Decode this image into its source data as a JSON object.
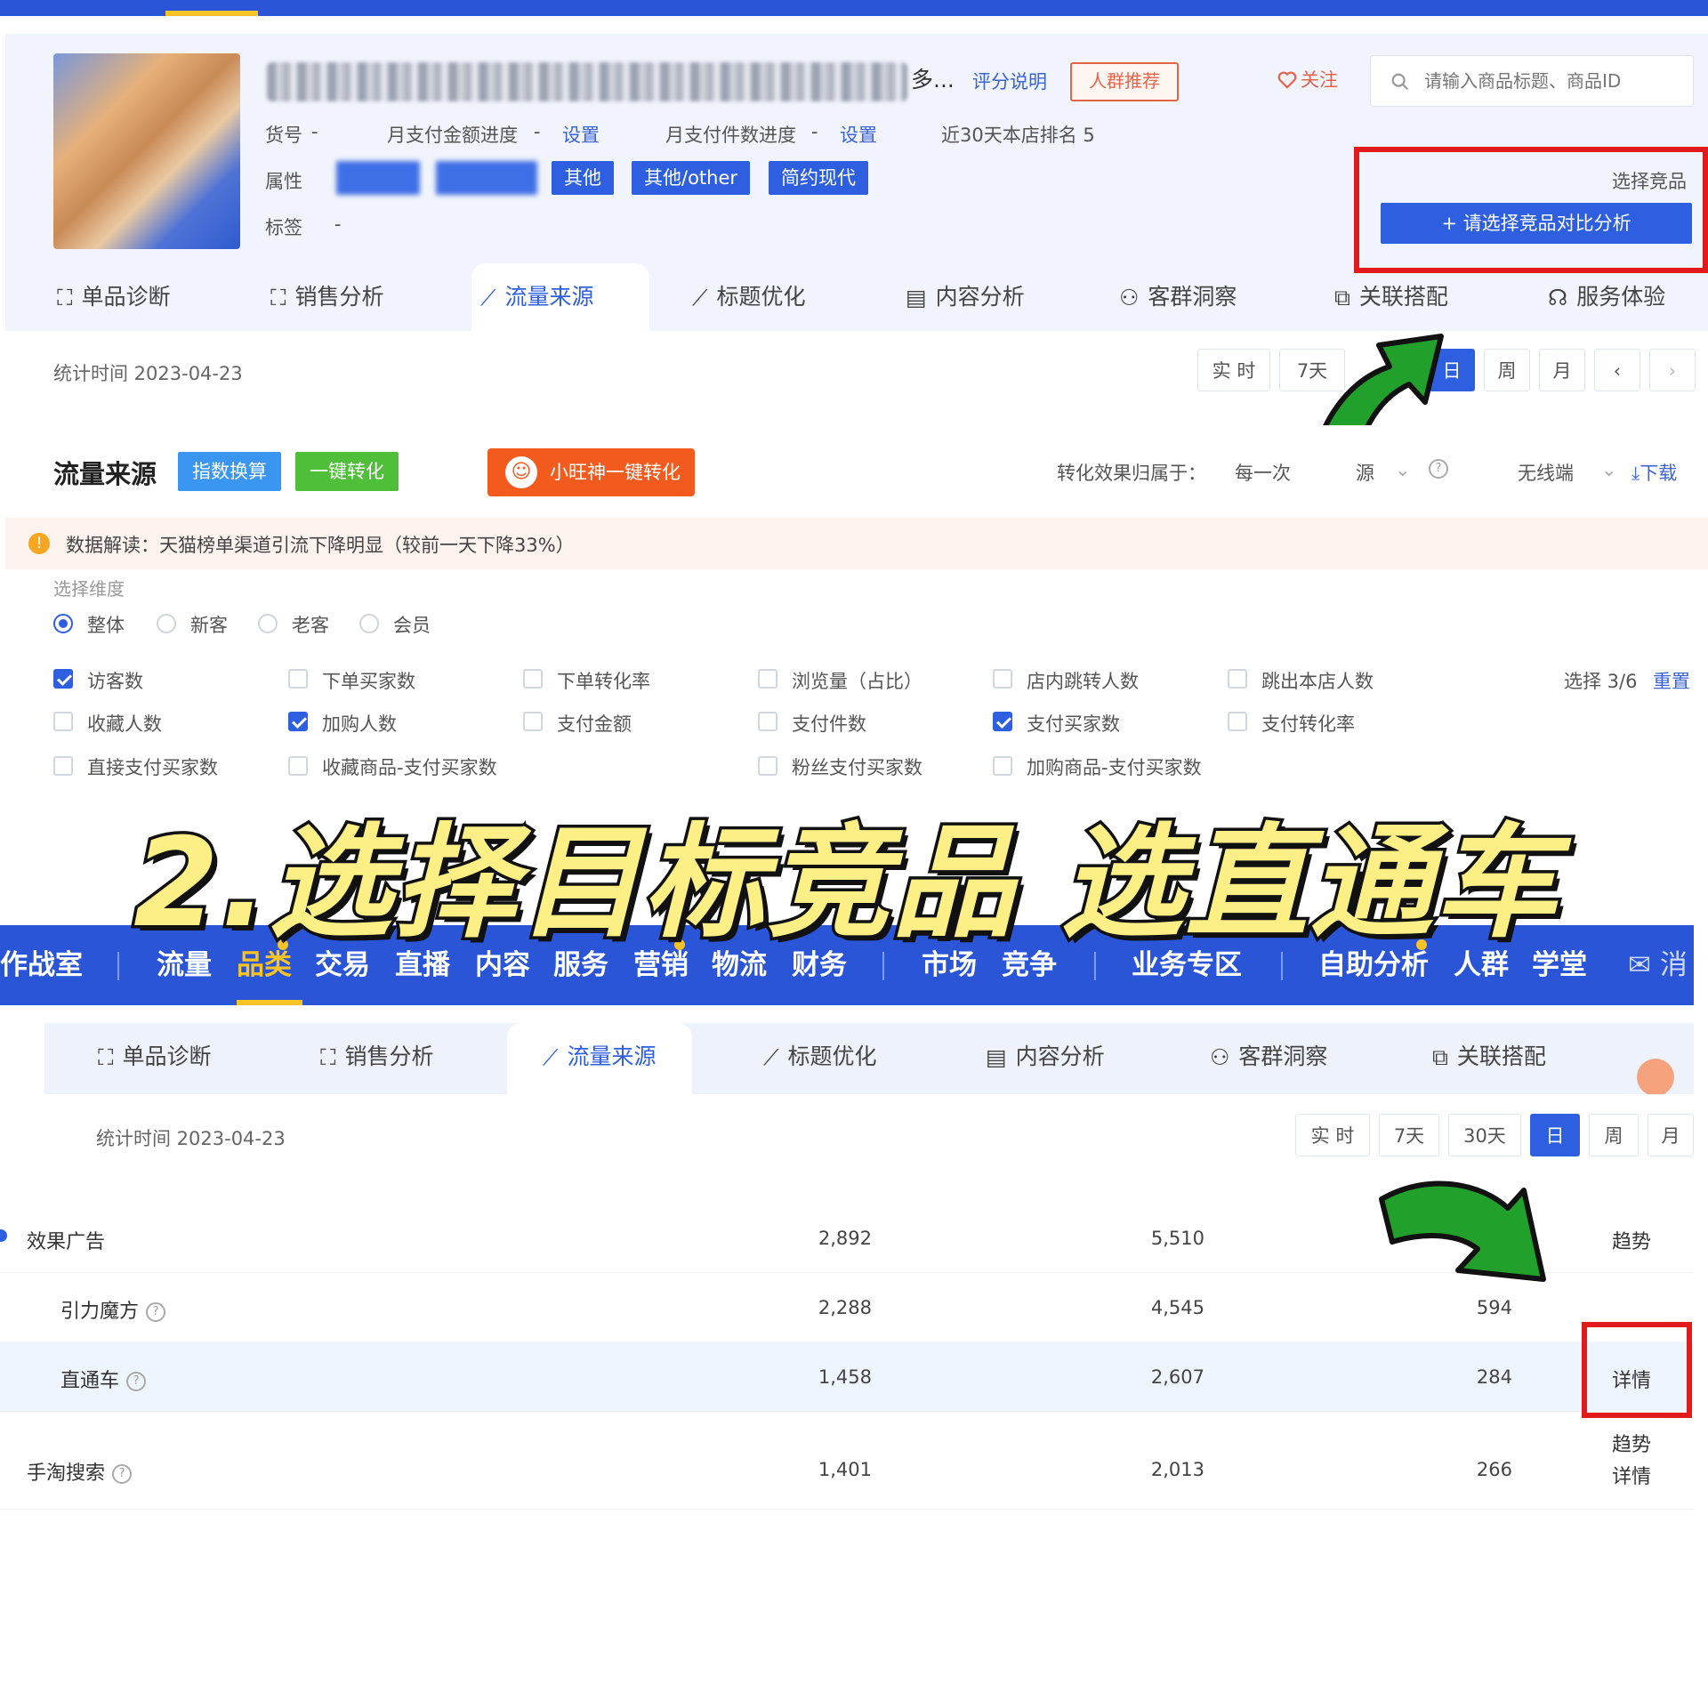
{
  "product": {
    "title_suffix": "多...",
    "rating_link": "评分说明",
    "crowd_button": "人群推荐",
    "follow": "关注",
    "search_placeholder": "请输入商品标题、商品ID",
    "sku_label": "货号",
    "sku_value": "-",
    "monthly_amount_label": "月支付金额进度",
    "monthly_amount_value": "-",
    "monthly_amount_set": "设置",
    "monthly_count_label": "月支付件数进度",
    "monthly_count_value": "-",
    "monthly_count_set": "设置",
    "rank_text": "近30天本店排名 5",
    "attr_label": "属性",
    "attrs": [
      "其他",
      "其他/other",
      "简约现代"
    ],
    "tag_label": "标签",
    "tag_value": "-",
    "compare_title": "选择竞品",
    "compare_button": "+ 请选择竞品对比分析"
  },
  "tabs": [
    "单品诊断",
    "销售分析",
    "流量来源",
    "标题优化",
    "内容分析",
    "客群洞察",
    "关联搭配",
    "服务体验"
  ],
  "stat": {
    "time_label": "统计时间 2023-04-23",
    "periods_top": [
      "实 时",
      "7天",
      "日",
      "周",
      "月"
    ],
    "periods_bottom": [
      "实 时",
      "7天",
      "30天",
      "日",
      "周",
      "月"
    ]
  },
  "traffic": {
    "title": "流量来源",
    "btn_index": "指数换算",
    "btn_convert": "一键转化",
    "btn_wang": "小旺神一键转化",
    "attribution_label": "转化效果归属于：",
    "attribution_value": "每一次",
    "attribution_tail": "源",
    "device": "无线端",
    "download": "下载",
    "notice": "数据解读：天猫榜单渠道引流下降明显（较前一天下降33%）",
    "dimension_label": "选择维度",
    "dimensions": [
      "整体",
      "新客",
      "老客",
      "会员"
    ],
    "metrics_row1": [
      "访客数",
      "下单买家数",
      "下单转化率",
      "浏览量（占比）",
      "店内跳转人数",
      "跳出本店人数"
    ],
    "metrics_row2": [
      "收藏人数",
      "加购人数",
      "支付金额",
      "支付件数",
      "支付买家数",
      "支付转化率"
    ],
    "metrics_row3": [
      "直接支付买家数",
      "收藏商品-支付买家数",
      "粉丝支付买家数",
      "加购商品-支付买家数"
    ],
    "select_count": "选择 3/6",
    "reset": "重置"
  },
  "overlay_text": "2.选择目标竞品 选直通车",
  "nav2": {
    "items": [
      "作战室",
      "流量",
      "品类",
      "交易",
      "直播",
      "内容",
      "服务",
      "营销",
      "物流",
      "财务",
      "市场",
      "竞争",
      "业务专区",
      "自助分析",
      "人群",
      "学堂",
      "消"
    ]
  },
  "tabs2": [
    "单品诊断",
    "销售分析",
    "流量来源",
    "标题优化",
    "内容分析",
    "客群洞察",
    "关联搭配"
  ],
  "table": [
    {
      "name": "效果广告",
      "v1": "2,892",
      "v2": "5,510",
      "v3": "",
      "actions": [
        "趋势"
      ]
    },
    {
      "name": "引力魔方",
      "v1": "2,288",
      "v2": "4,545",
      "v3": "594",
      "actions": []
    },
    {
      "name": "直通车",
      "v1": "1,458",
      "v2": "2,607",
      "v3": "284",
      "actions": [
        "详情"
      ]
    },
    {
      "name": "手淘搜索",
      "v1": "1,401",
      "v2": "2,013",
      "v3": "266",
      "actions": [
        "趋势",
        "详情"
      ]
    }
  ],
  "colors": {
    "brand_blue": "#2e5fe0",
    "highlight_red": "#e11b1b",
    "arrow_green": "#22a02c",
    "overlay_yellow": "#fbef86"
  }
}
